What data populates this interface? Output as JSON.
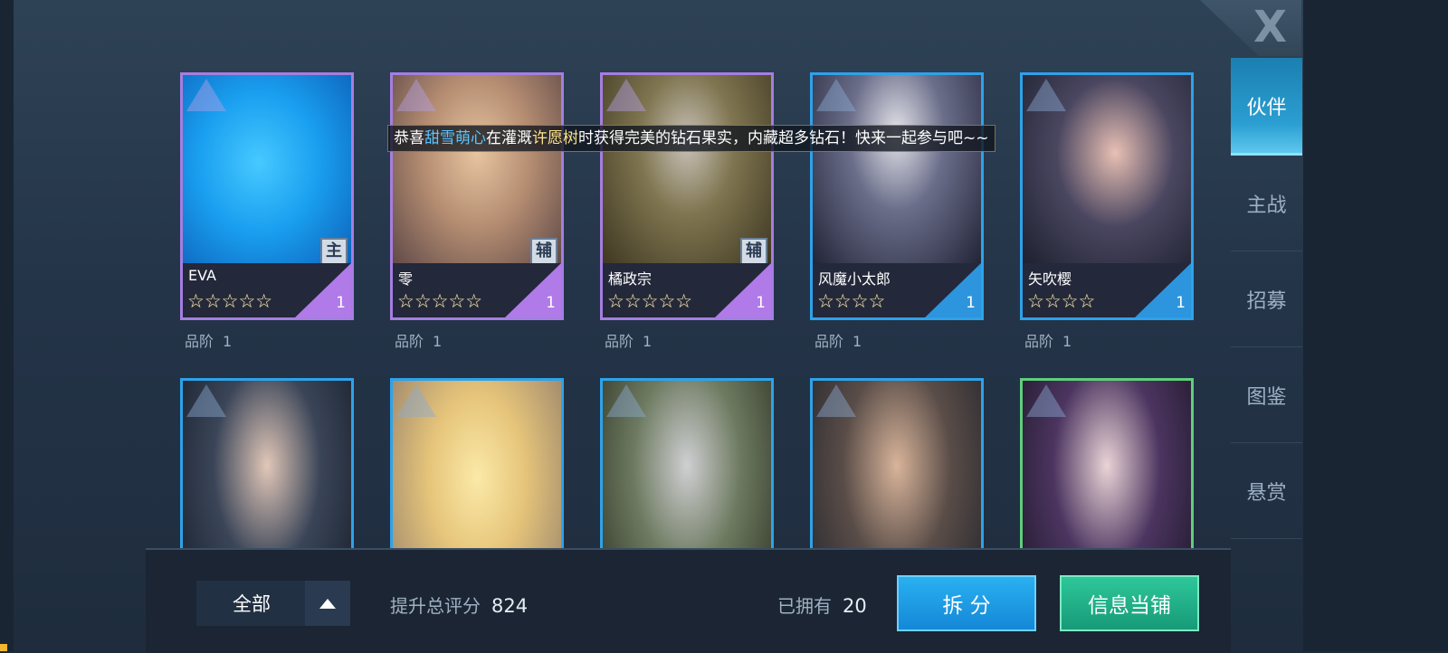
{
  "close_label": "X",
  "tabs": [
    {
      "label": "伙伴",
      "active": true
    },
    {
      "label": "主战",
      "active": false
    },
    {
      "label": "招募",
      "active": false
    },
    {
      "label": "图鉴",
      "active": false
    },
    {
      "label": "悬赏",
      "active": false
    }
  ],
  "cards_row1": [
    {
      "name": "EVA",
      "stars": "☆☆☆☆☆",
      "star_count": 5,
      "level": "1",
      "role": "主",
      "grade_label": "品阶",
      "grade": "1",
      "frame": "purple"
    },
    {
      "name": "零",
      "stars": "☆☆☆☆☆",
      "star_count": 5,
      "level": "1",
      "role": "辅",
      "grade_label": "品阶",
      "grade": "1",
      "frame": "purple"
    },
    {
      "name": "橘政宗",
      "stars": "☆☆☆☆☆",
      "star_count": 5,
      "level": "1",
      "role": "辅",
      "grade_label": "品阶",
      "grade": "1",
      "frame": "purple"
    },
    {
      "name": "风魔小太郎",
      "stars": "☆☆☆☆",
      "star_count": 4,
      "level": "1",
      "grade_label": "品阶",
      "grade": "1",
      "frame": "blue"
    },
    {
      "name": "矢吹樱",
      "stars": "☆☆☆☆",
      "star_count": 4,
      "level": "1",
      "grade_label": "品阶",
      "grade": "1",
      "frame": "blue"
    }
  ],
  "cards_row2_frames": [
    "blue",
    "blue",
    "blue",
    "blue",
    "green"
  ],
  "announcement": {
    "prefix": "恭喜",
    "user": "甜雪萌心",
    "middle": "在灌溉",
    "place": "许愿树",
    "suffix": "时获得完美的钻石果实，内藏超多钻石！快来一起参与吧~~"
  },
  "bottom": {
    "filter_label": "全部",
    "score_label": "提升总评分",
    "score_value": "824",
    "owned_label": "已拥有",
    "owned_value": "20",
    "split_button": "拆 分",
    "pawn_button": "信息当铺"
  },
  "colors": {
    "purple_frame": "#a57ee0",
    "blue_frame": "#2ea2ea",
    "green_frame": "#5fce7b",
    "split_button": "#1e9be4",
    "pawn_button": "#1fb087"
  }
}
